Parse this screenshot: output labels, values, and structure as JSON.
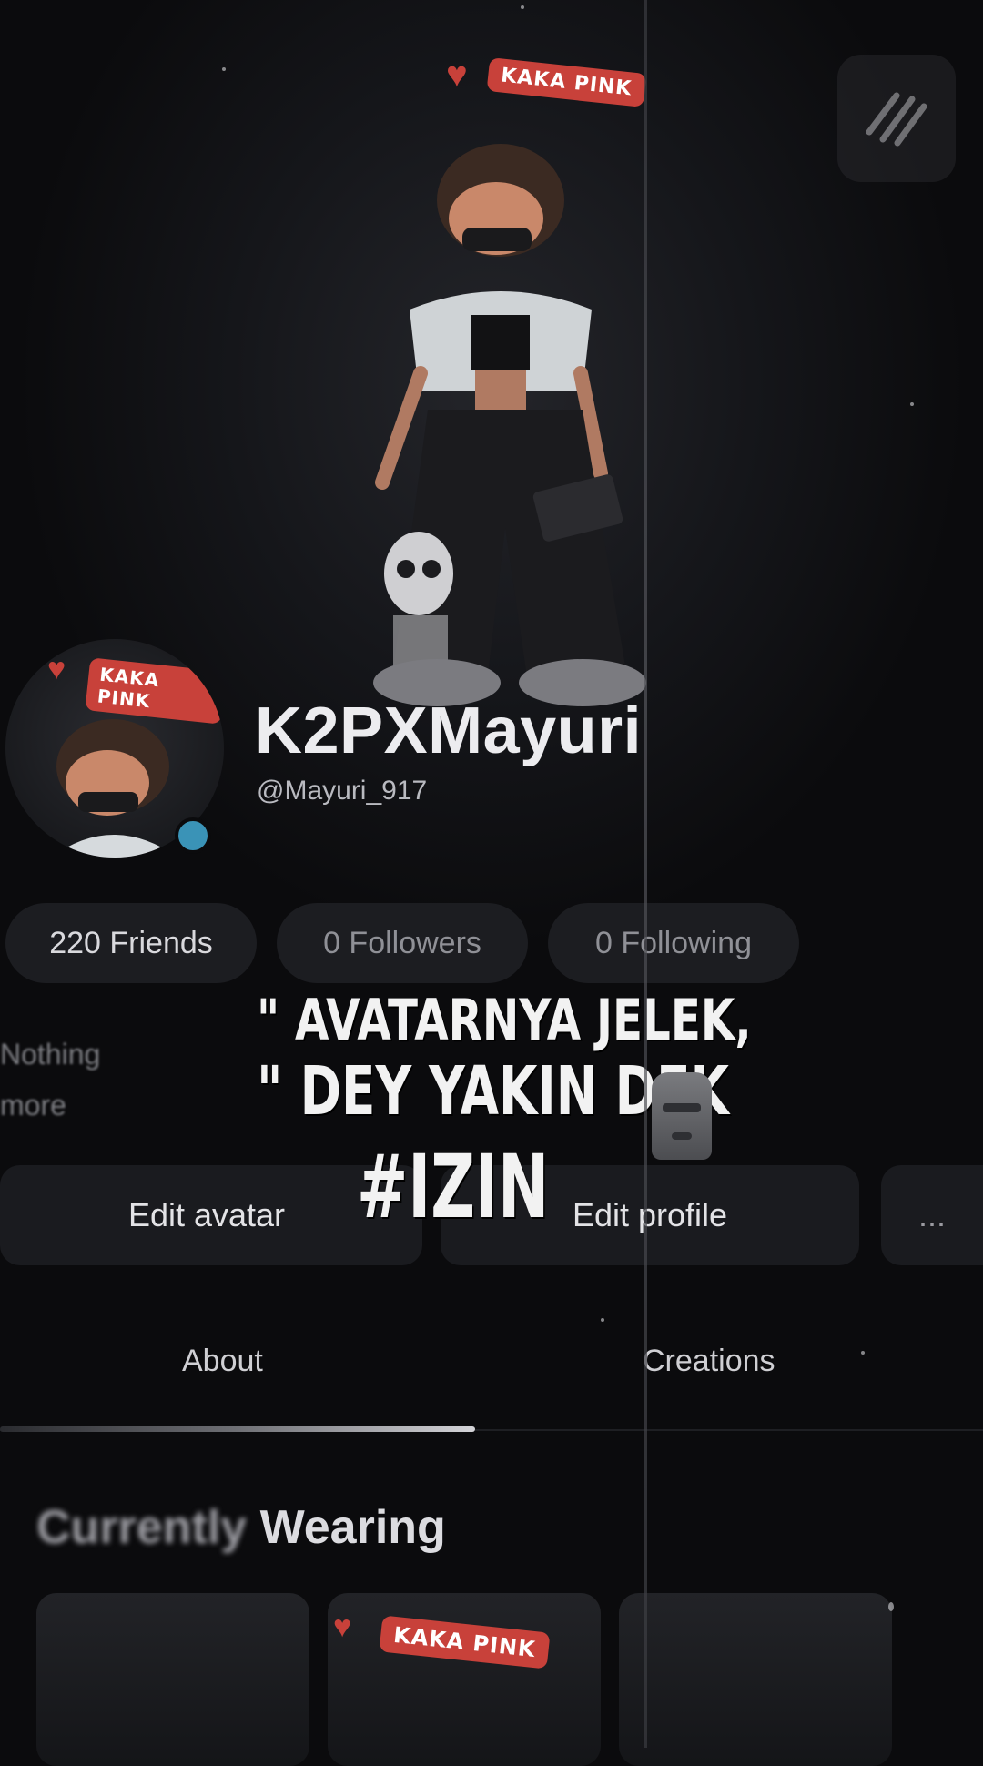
{
  "profile": {
    "display_name": "K2PXMayuri",
    "username": "@Mayuri_917"
  },
  "badge": {
    "text": "KAKA PINK"
  },
  "stats": {
    "friends": "220 Friends",
    "followers": "0 Followers",
    "following": "0 Following"
  },
  "bio": {
    "line1": "Nothing",
    "line2": "more"
  },
  "caption": {
    "line1": "\" AVATARNYA JELEK,",
    "line2": "\" DEY YAKIN DEK",
    "line3": "#IZIN"
  },
  "actions": {
    "edit_avatar": "Edit avatar",
    "edit_profile": "Edit profile",
    "more": "..."
  },
  "tabs": {
    "about": "About",
    "creations": "Creations"
  },
  "section": {
    "title_part1": "Currently",
    "title_part2": " Wearing"
  },
  "colors": {
    "background": "#0b0b0d",
    "pill_bg": "#1c1d21",
    "online_dot": "#3a93b7",
    "badge_red": "#c8413a"
  },
  "icons": {
    "top_right": "pencil-lines-icon",
    "online": "online-status-icon",
    "emoji": "moai-icon"
  }
}
